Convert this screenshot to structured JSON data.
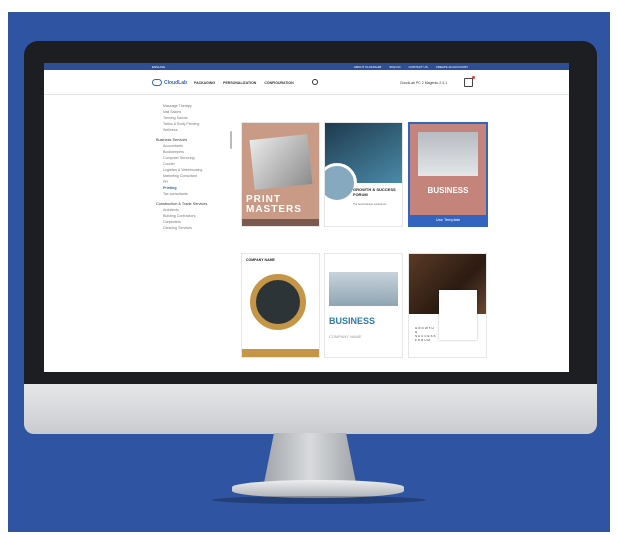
{
  "colors": {
    "background": "#2f55a2",
    "accent": "#3264c0",
    "topbar": "#2f4f95"
  },
  "topbar": {
    "language": "ENGLISH",
    "links": [
      "ABOUT CLOUDLAB",
      "SIGN IN",
      "CONTACT US",
      "CREATE AN ACCOUNT"
    ]
  },
  "header": {
    "logo": "CloudLab",
    "nav": [
      "PACKAGING",
      "PERSONALIZATION",
      "CONFIGURATION"
    ],
    "account": "CloudLab PC 2 Magento 2.4.1",
    "search_icon": "search-icon",
    "cart_icon": "cart-icon"
  },
  "sidebar": {
    "group1": [
      "Massage Therapy",
      "Nail Salons",
      "Tanning Salons",
      "Tattoo & Body Piercing",
      "Wellness"
    ],
    "heading2": "Business Services",
    "group2": [
      "Accountants",
      "Bookkeepers",
      "Computer Servicing",
      "Courier",
      "Logistics & Warehousing",
      "Marketing Consultant",
      "PR",
      "Printing",
      "Tax consultants"
    ],
    "active_index": 7,
    "heading3": "Construction & Trade Services",
    "group3": [
      "Architects",
      "Building Contractors",
      "Carpenters",
      "Cleaning Services"
    ]
  },
  "cards": {
    "c1": {
      "title": "PRINT MASTERS"
    },
    "c2": {
      "title": "GROWTH & SUCCESS FORUM",
      "sub": "The best business conference"
    },
    "c3": {
      "title": "BUSINESS",
      "button": "Use Template"
    },
    "c4": {
      "label": "COMPANY NAME"
    },
    "c5": {
      "title": "BUSINESS",
      "sub": "COMPANY NAME"
    },
    "c6": {
      "title": "GROWTH & SUCCESS FORUM"
    }
  }
}
